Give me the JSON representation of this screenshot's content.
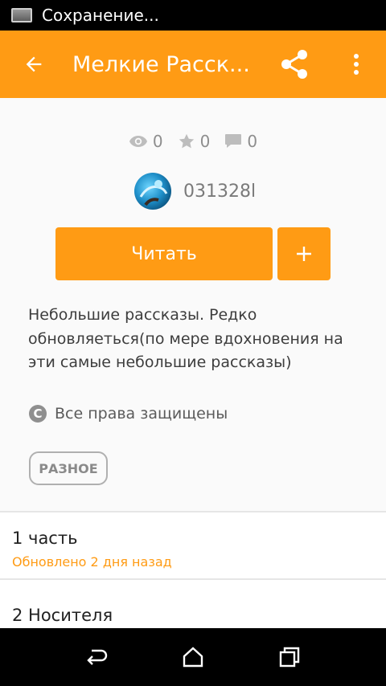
{
  "status_bar": {
    "text": "Сохранение..."
  },
  "app_bar": {
    "title": "Мелкие Расск..."
  },
  "stats": {
    "views": "0",
    "votes": "0",
    "comments": "0"
  },
  "author": {
    "name": "031328l"
  },
  "buttons": {
    "read_label": "Читать",
    "add_label": "+"
  },
  "description": "Небольшие рассказы. Редко обновляеться(по мере вдохновения на эти самые небольшие рассказы)",
  "copyright": {
    "text": "Все права защищены",
    "symbol": "C"
  },
  "tag": "РАЗНОЕ",
  "parts": [
    {
      "title": "1 часть",
      "subtitle": "Обновлено 2 дня назад"
    },
    {
      "title": "2 Носителя"
    }
  ],
  "colors": {
    "accent": "#ff9b14",
    "muted": "#8e8e8e"
  }
}
